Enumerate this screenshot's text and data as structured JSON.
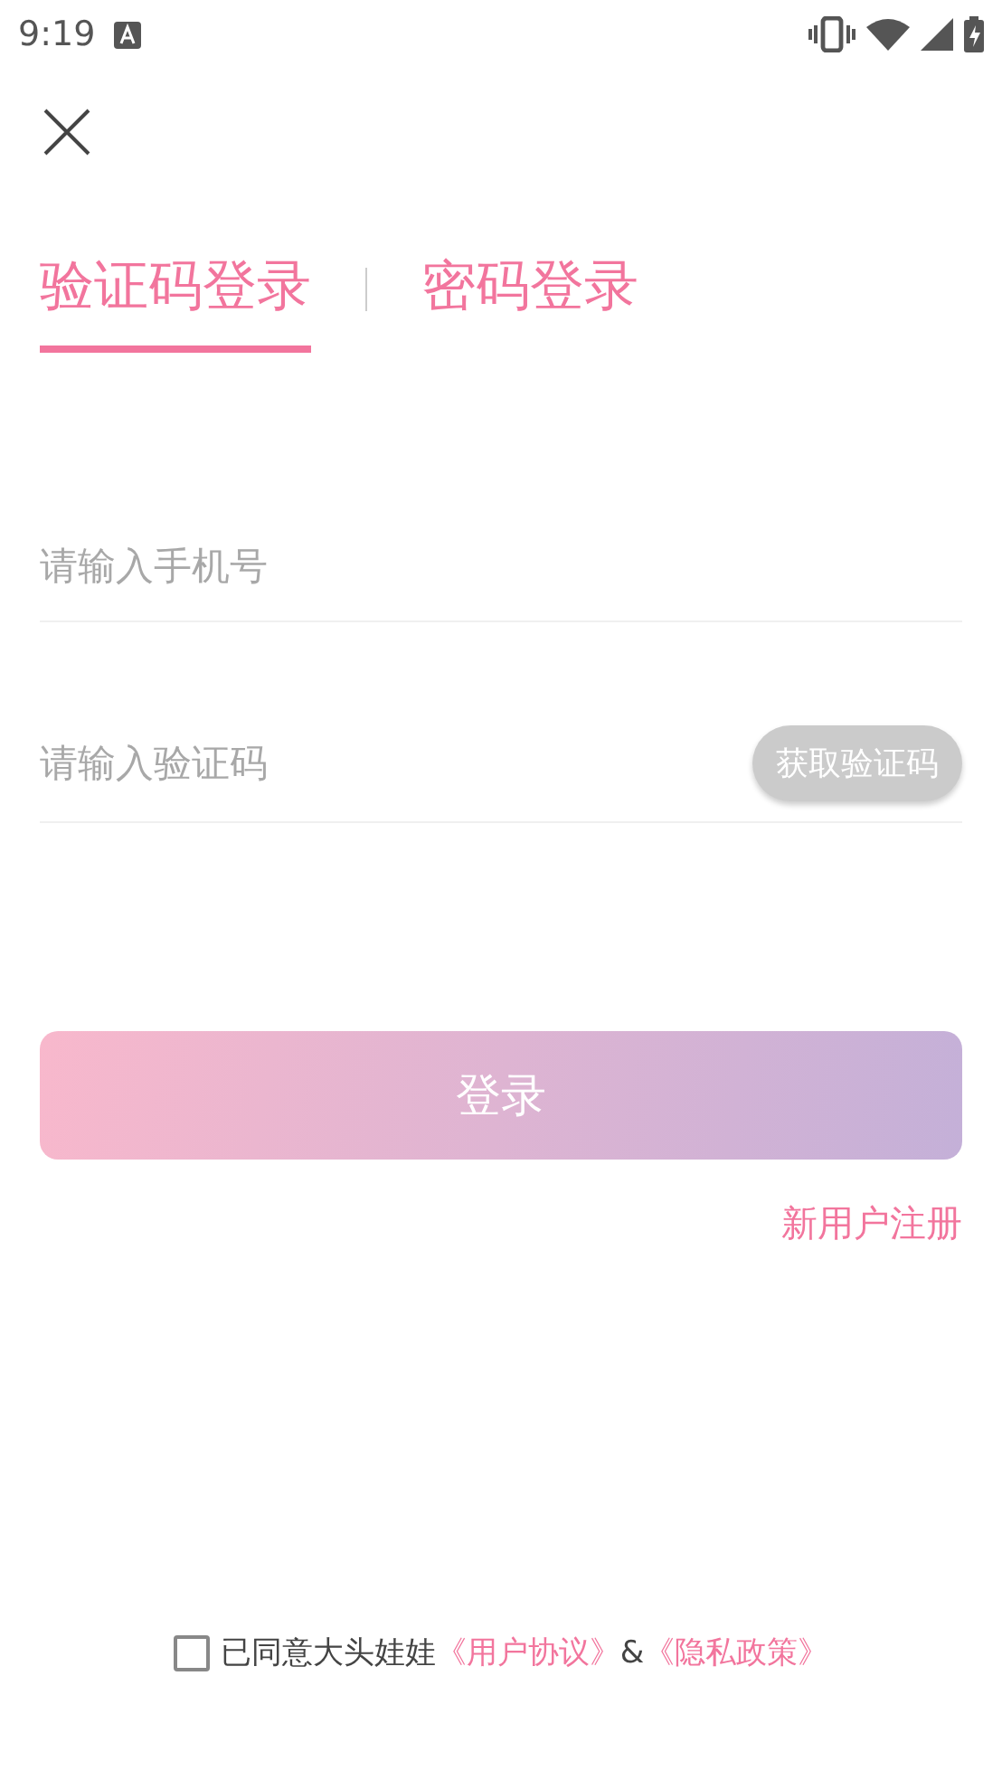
{
  "status_bar": {
    "time": "9:19"
  },
  "tabs": [
    {
      "label": "验证码登录",
      "selected": true
    },
    {
      "label": "密码登录",
      "selected": false
    }
  ],
  "phone_field": {
    "placeholder": "请输入手机号"
  },
  "code_field": {
    "placeholder": "请输入验证码",
    "button": "获取验证码"
  },
  "login_button": "登录",
  "register_link": "新用户注册",
  "agreement": {
    "checked": false,
    "text": "已同意大头娃娃",
    "link_1": "《用户协议》",
    "separator": "&",
    "link_2": "《隐私政策》"
  }
}
